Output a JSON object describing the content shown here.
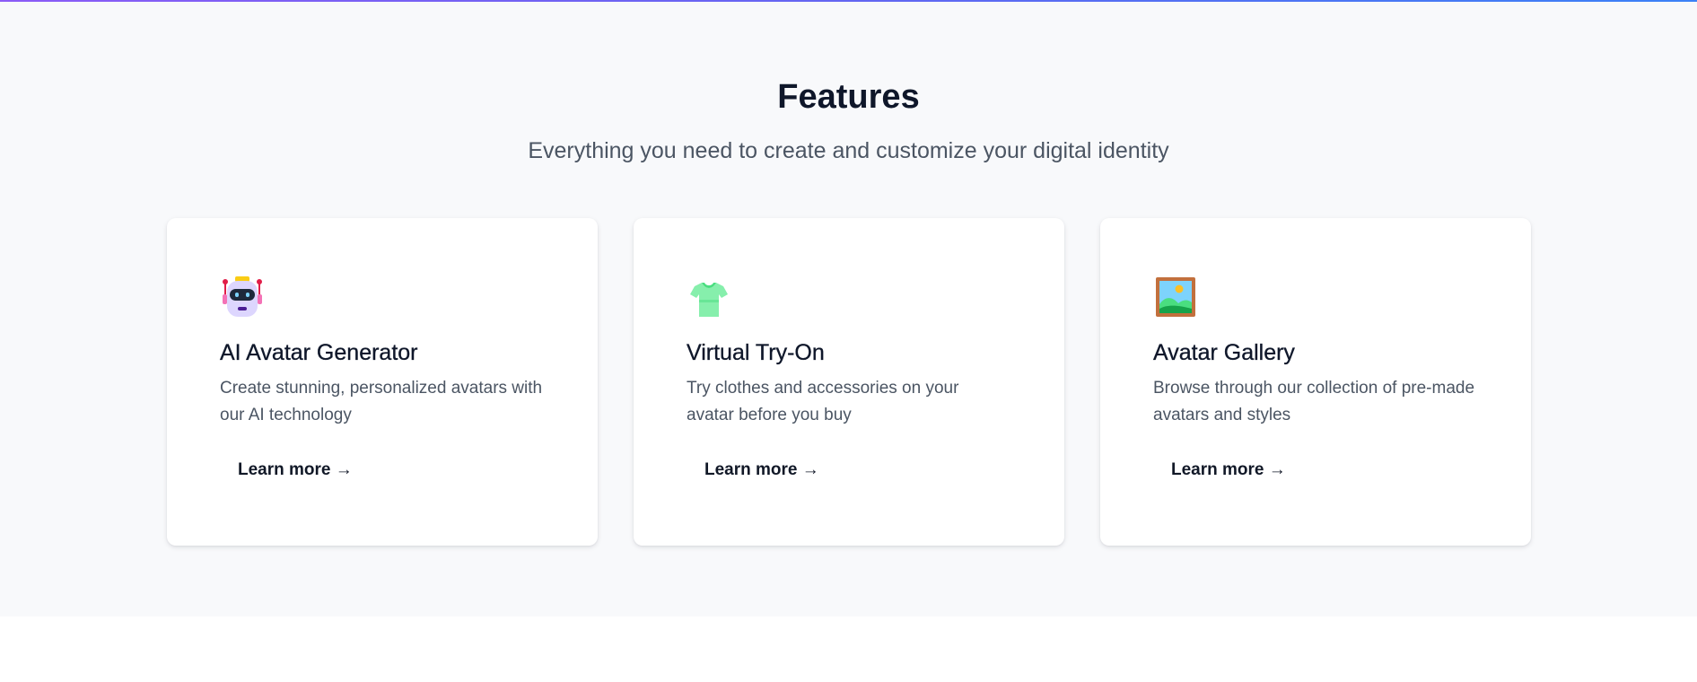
{
  "features": {
    "title": "Features",
    "subtitle": "Everything you need to create and customize your digital identity",
    "cards": [
      {
        "icon": "robot-icon",
        "title": "AI Avatar Generator",
        "description": "Create stunning, personalized avatars with our AI technology",
        "link_label": "Learn more →"
      },
      {
        "icon": "t-shirt-icon",
        "title": "Virtual Try-On",
        "description": "Try clothes and accessories on your avatar before you buy",
        "link_label": "Learn more →"
      },
      {
        "icon": "framed-picture-icon",
        "title": "Avatar Gallery",
        "description": "Browse through our collection of pre-made avatars and styles",
        "link_label": "Learn more →"
      }
    ]
  },
  "colors": {
    "section_background": "#f8f9fb",
    "heading": "#0f172a",
    "body_text": "#4b5563",
    "accent_gradient_start": "#8b5cf6",
    "accent_gradient_end": "#3b82f6"
  }
}
